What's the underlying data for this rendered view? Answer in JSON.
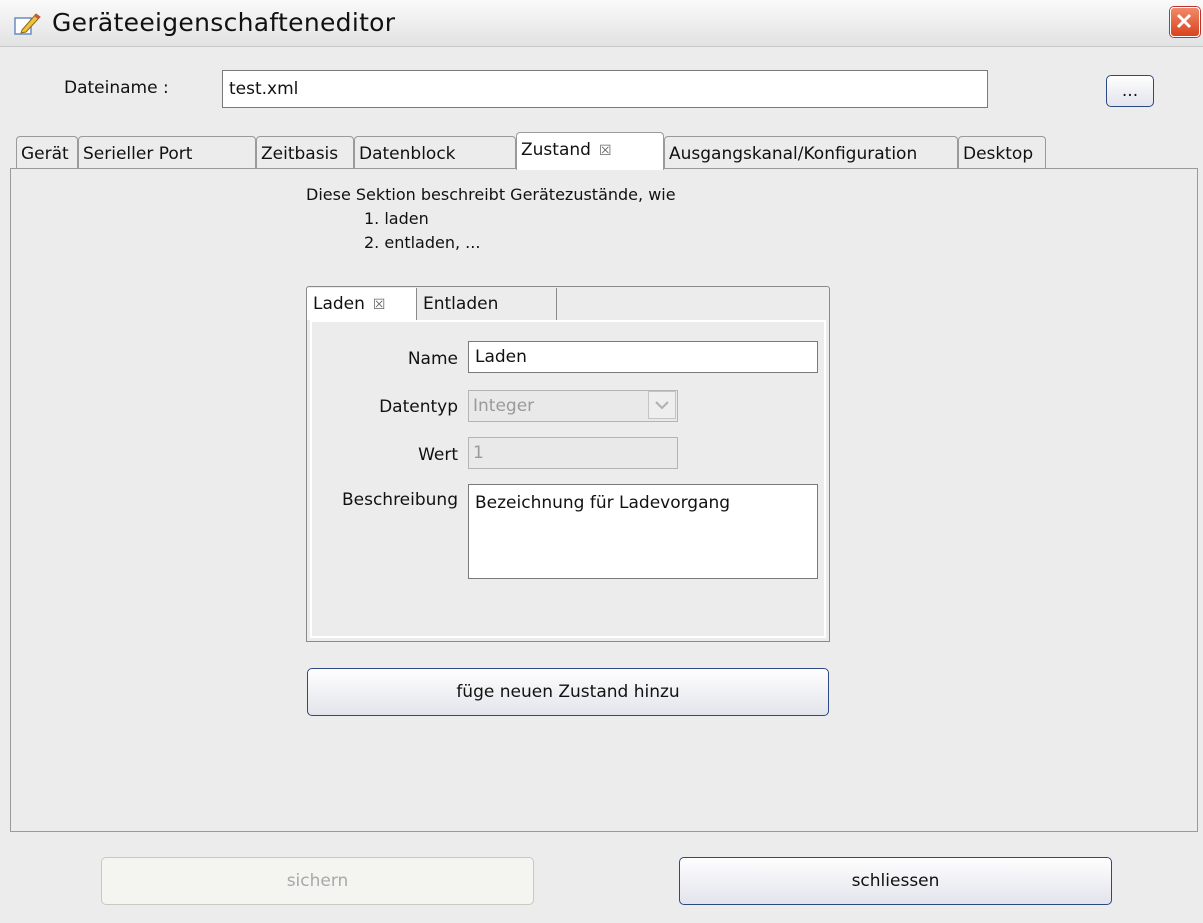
{
  "window": {
    "title": "Geräteeigenschafteneditor"
  },
  "file": {
    "label": "Dateiname :",
    "value": "test.xml",
    "browse_label": "..."
  },
  "tabs": [
    {
      "label": "Gerät"
    },
    {
      "label": "Serieller Port"
    },
    {
      "label": "Zeitbasis"
    },
    {
      "label": "Datenblock"
    },
    {
      "label": "Zustand",
      "active": true
    },
    {
      "label": "Ausgangskanal/Konfiguration"
    },
    {
      "label": "Desktop"
    }
  ],
  "section": {
    "intro": "Diese Sektion beschreibt Gerätezustände, wie",
    "item1": "1. laden",
    "item2": "2. entladen, ..."
  },
  "state_tabs": [
    {
      "label": "Laden",
      "active": true
    },
    {
      "label": "Entladen"
    }
  ],
  "form": {
    "name_label": "Name",
    "name_value": "Laden",
    "type_label": "Datentyp",
    "type_value": "Integer",
    "value_label": "Wert",
    "value_value": "1",
    "desc_label": "Beschreibung",
    "desc_value": "Bezeichnung für Ladevorgang"
  },
  "add_state_label": "füge neuen Zustand hinzu",
  "footer": {
    "save_label": "sichern",
    "close_label": "schliessen"
  },
  "icons": {
    "close_tab": "close-tab-icon",
    "window": "edit-pencil-icon"
  }
}
